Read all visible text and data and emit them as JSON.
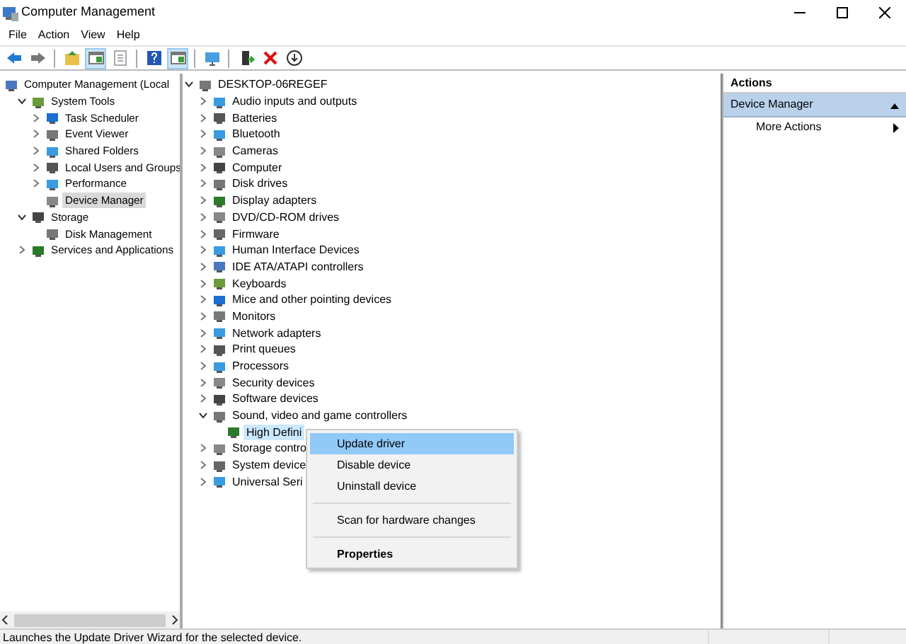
{
  "window": {
    "title": "Computer Management"
  },
  "menu": [
    "File",
    "Action",
    "View",
    "Help"
  ],
  "toolbar": [
    {
      "kind": "back",
      "pressed": false
    },
    {
      "kind": "forward",
      "pressed": false
    },
    {
      "kind": "up",
      "pressed": false
    },
    {
      "kind": "pane",
      "pressed": true
    },
    {
      "kind": "properties",
      "pressed": false
    },
    {
      "kind": "help",
      "pressed": false
    },
    {
      "kind": "pane",
      "pressed": true
    },
    {
      "kind": "monitor",
      "pressed": false
    },
    {
      "kind": "driver",
      "pressed": false
    },
    {
      "kind": "remove",
      "pressed": false
    },
    {
      "kind": "download",
      "pressed": false
    }
  ],
  "console_tree": [
    {
      "label": "Computer Management (Local",
      "selected": false,
      "children": [
        {
          "label": "System Tools",
          "expanded": true,
          "selected": false,
          "children": [
            {
              "label": "Task Scheduler",
              "expanded": false,
              "selected": false
            },
            {
              "label": "Event Viewer",
              "expanded": false,
              "selected": false
            },
            {
              "label": "Shared Folders",
              "expanded": false,
              "selected": false
            },
            {
              "label": "Local Users and Groups",
              "expanded": false,
              "selected": false
            },
            {
              "label": "Performance",
              "expanded": false,
              "selected": false
            },
            {
              "label": "Device Manager",
              "selected": true
            }
          ]
        },
        {
          "label": "Storage",
          "expanded": true,
          "selected": false,
          "children": [
            {
              "label": "Disk Management",
              "selected": false
            }
          ]
        },
        {
          "label": "Services and Applications",
          "expanded": false,
          "selected": false
        }
      ]
    }
  ],
  "device_tree": [
    {
      "label": "DESKTOP-06REGEF",
      "expanded": true,
      "selected": false,
      "children": [
        {
          "label": "Audio inputs and outputs",
          "expanded": false,
          "selected": false
        },
        {
          "label": "Batteries",
          "expanded": false,
          "selected": false
        },
        {
          "label": "Bluetooth",
          "expanded": false,
          "selected": false
        },
        {
          "label": "Cameras",
          "expanded": false,
          "selected": false
        },
        {
          "label": "Computer",
          "expanded": false,
          "selected": false
        },
        {
          "label": "Disk drives",
          "expanded": false,
          "selected": false
        },
        {
          "label": "Display adapters",
          "expanded": false,
          "selected": false
        },
        {
          "label": "DVD/CD-ROM drives",
          "expanded": false,
          "selected": false
        },
        {
          "label": "Firmware",
          "expanded": false,
          "selected": false
        },
        {
          "label": "Human Interface Devices",
          "expanded": false,
          "selected": false
        },
        {
          "label": "IDE ATA/ATAPI controllers",
          "expanded": false,
          "selected": false
        },
        {
          "label": "Keyboards",
          "expanded": false,
          "selected": false
        },
        {
          "label": "Mice and other pointing devices",
          "expanded": false,
          "selected": false
        },
        {
          "label": "Monitors",
          "expanded": false,
          "selected": false
        },
        {
          "label": "Network adapters",
          "expanded": false,
          "selected": false
        },
        {
          "label": "Print queues",
          "expanded": false,
          "selected": false
        },
        {
          "label": "Processors",
          "expanded": false,
          "selected": false
        },
        {
          "label": "Security devices",
          "expanded": false,
          "selected": false
        },
        {
          "label": "Software devices",
          "expanded": false,
          "selected": false
        },
        {
          "label": "Sound, video and game controllers",
          "expanded": true,
          "selected": false,
          "children": [
            {
              "label": "High Defini",
              "selected": true
            }
          ]
        },
        {
          "label": "Storage contro",
          "expanded": false,
          "selected": false
        },
        {
          "label": "System device",
          "expanded": false,
          "selected": false
        },
        {
          "label": "Universal Seri",
          "expanded": false,
          "selected": false
        }
      ]
    }
  ],
  "context_menu": [
    {
      "label": "Update driver",
      "selected": true,
      "bold": false,
      "separator_before": false
    },
    {
      "label": "Disable device",
      "selected": false,
      "bold": false,
      "separator_before": false
    },
    {
      "label": "Uninstall device",
      "selected": false,
      "bold": false,
      "separator_before": false
    },
    {
      "label": "Scan for hardware changes",
      "selected": false,
      "bold": false,
      "separator_before": true
    },
    {
      "label": "Properties",
      "selected": false,
      "bold": true,
      "separator_before": true
    }
  ],
  "actions": {
    "title": "Actions",
    "section": "Device Manager",
    "items": [
      "More Actions"
    ]
  },
  "status_bar": "Launches the Update Driver Wizard for the selected device."
}
